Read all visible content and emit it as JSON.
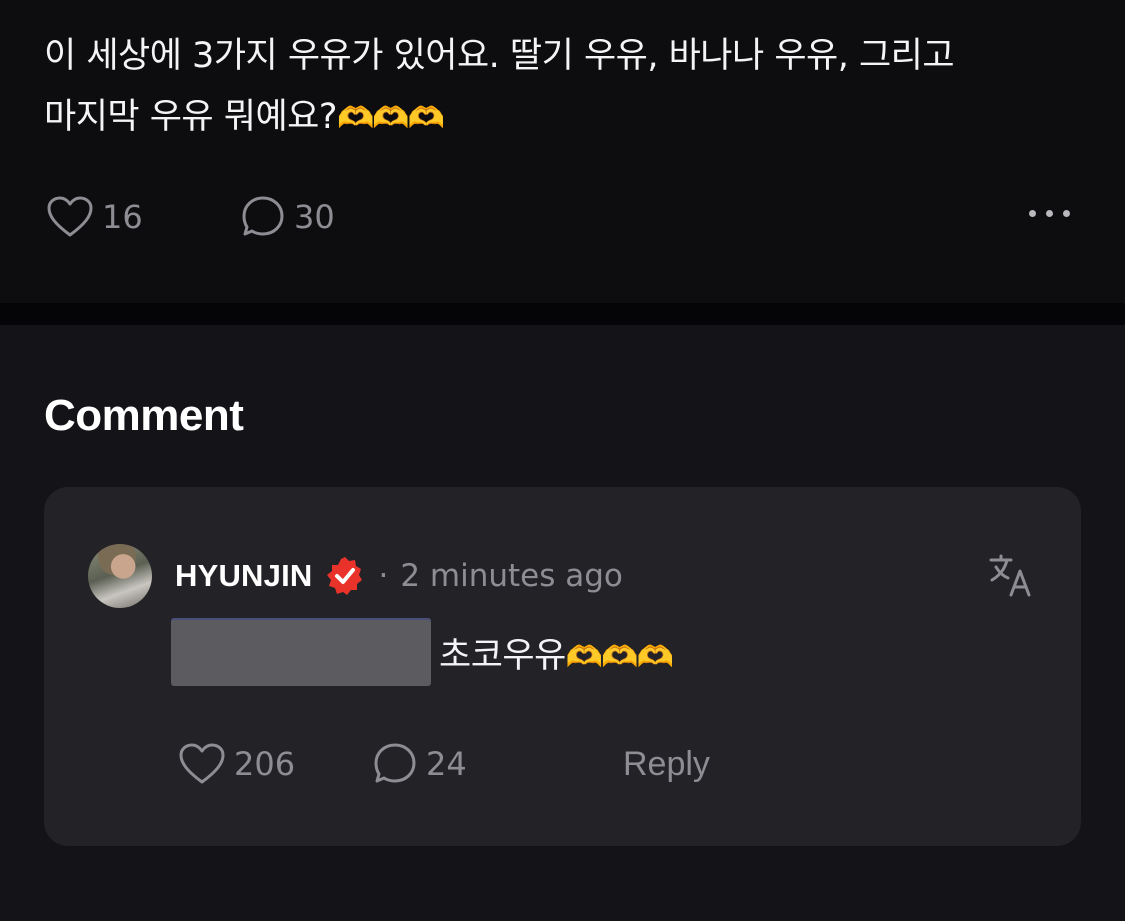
{
  "post": {
    "text_line1": "이 세상에 3가지 우유가 있어요. 딸기 우유, 바나나 우유, 그리고",
    "text_line2": "마지막 우유 뭐예요?",
    "emoji": "🫶🫶🫶",
    "like_count": "16",
    "comment_count": "30"
  },
  "comments_section": {
    "title": "Comment"
  },
  "comment": {
    "username": "HYUNJIN",
    "separator": "·",
    "time": "2 minutes ago",
    "text": "초코우유",
    "emoji": "🫶🫶🫶",
    "like_count": "206",
    "reply_count": "24",
    "reply_label": "Reply"
  },
  "colors": {
    "background": "#0d0d10",
    "card": "#222227",
    "muted_text": "#8d8d93",
    "verified_badge": "#e8322a"
  },
  "icons": [
    "heart-icon",
    "comment-bubble-icon",
    "more-icon",
    "verified-badge-icon",
    "translate-icon"
  ]
}
